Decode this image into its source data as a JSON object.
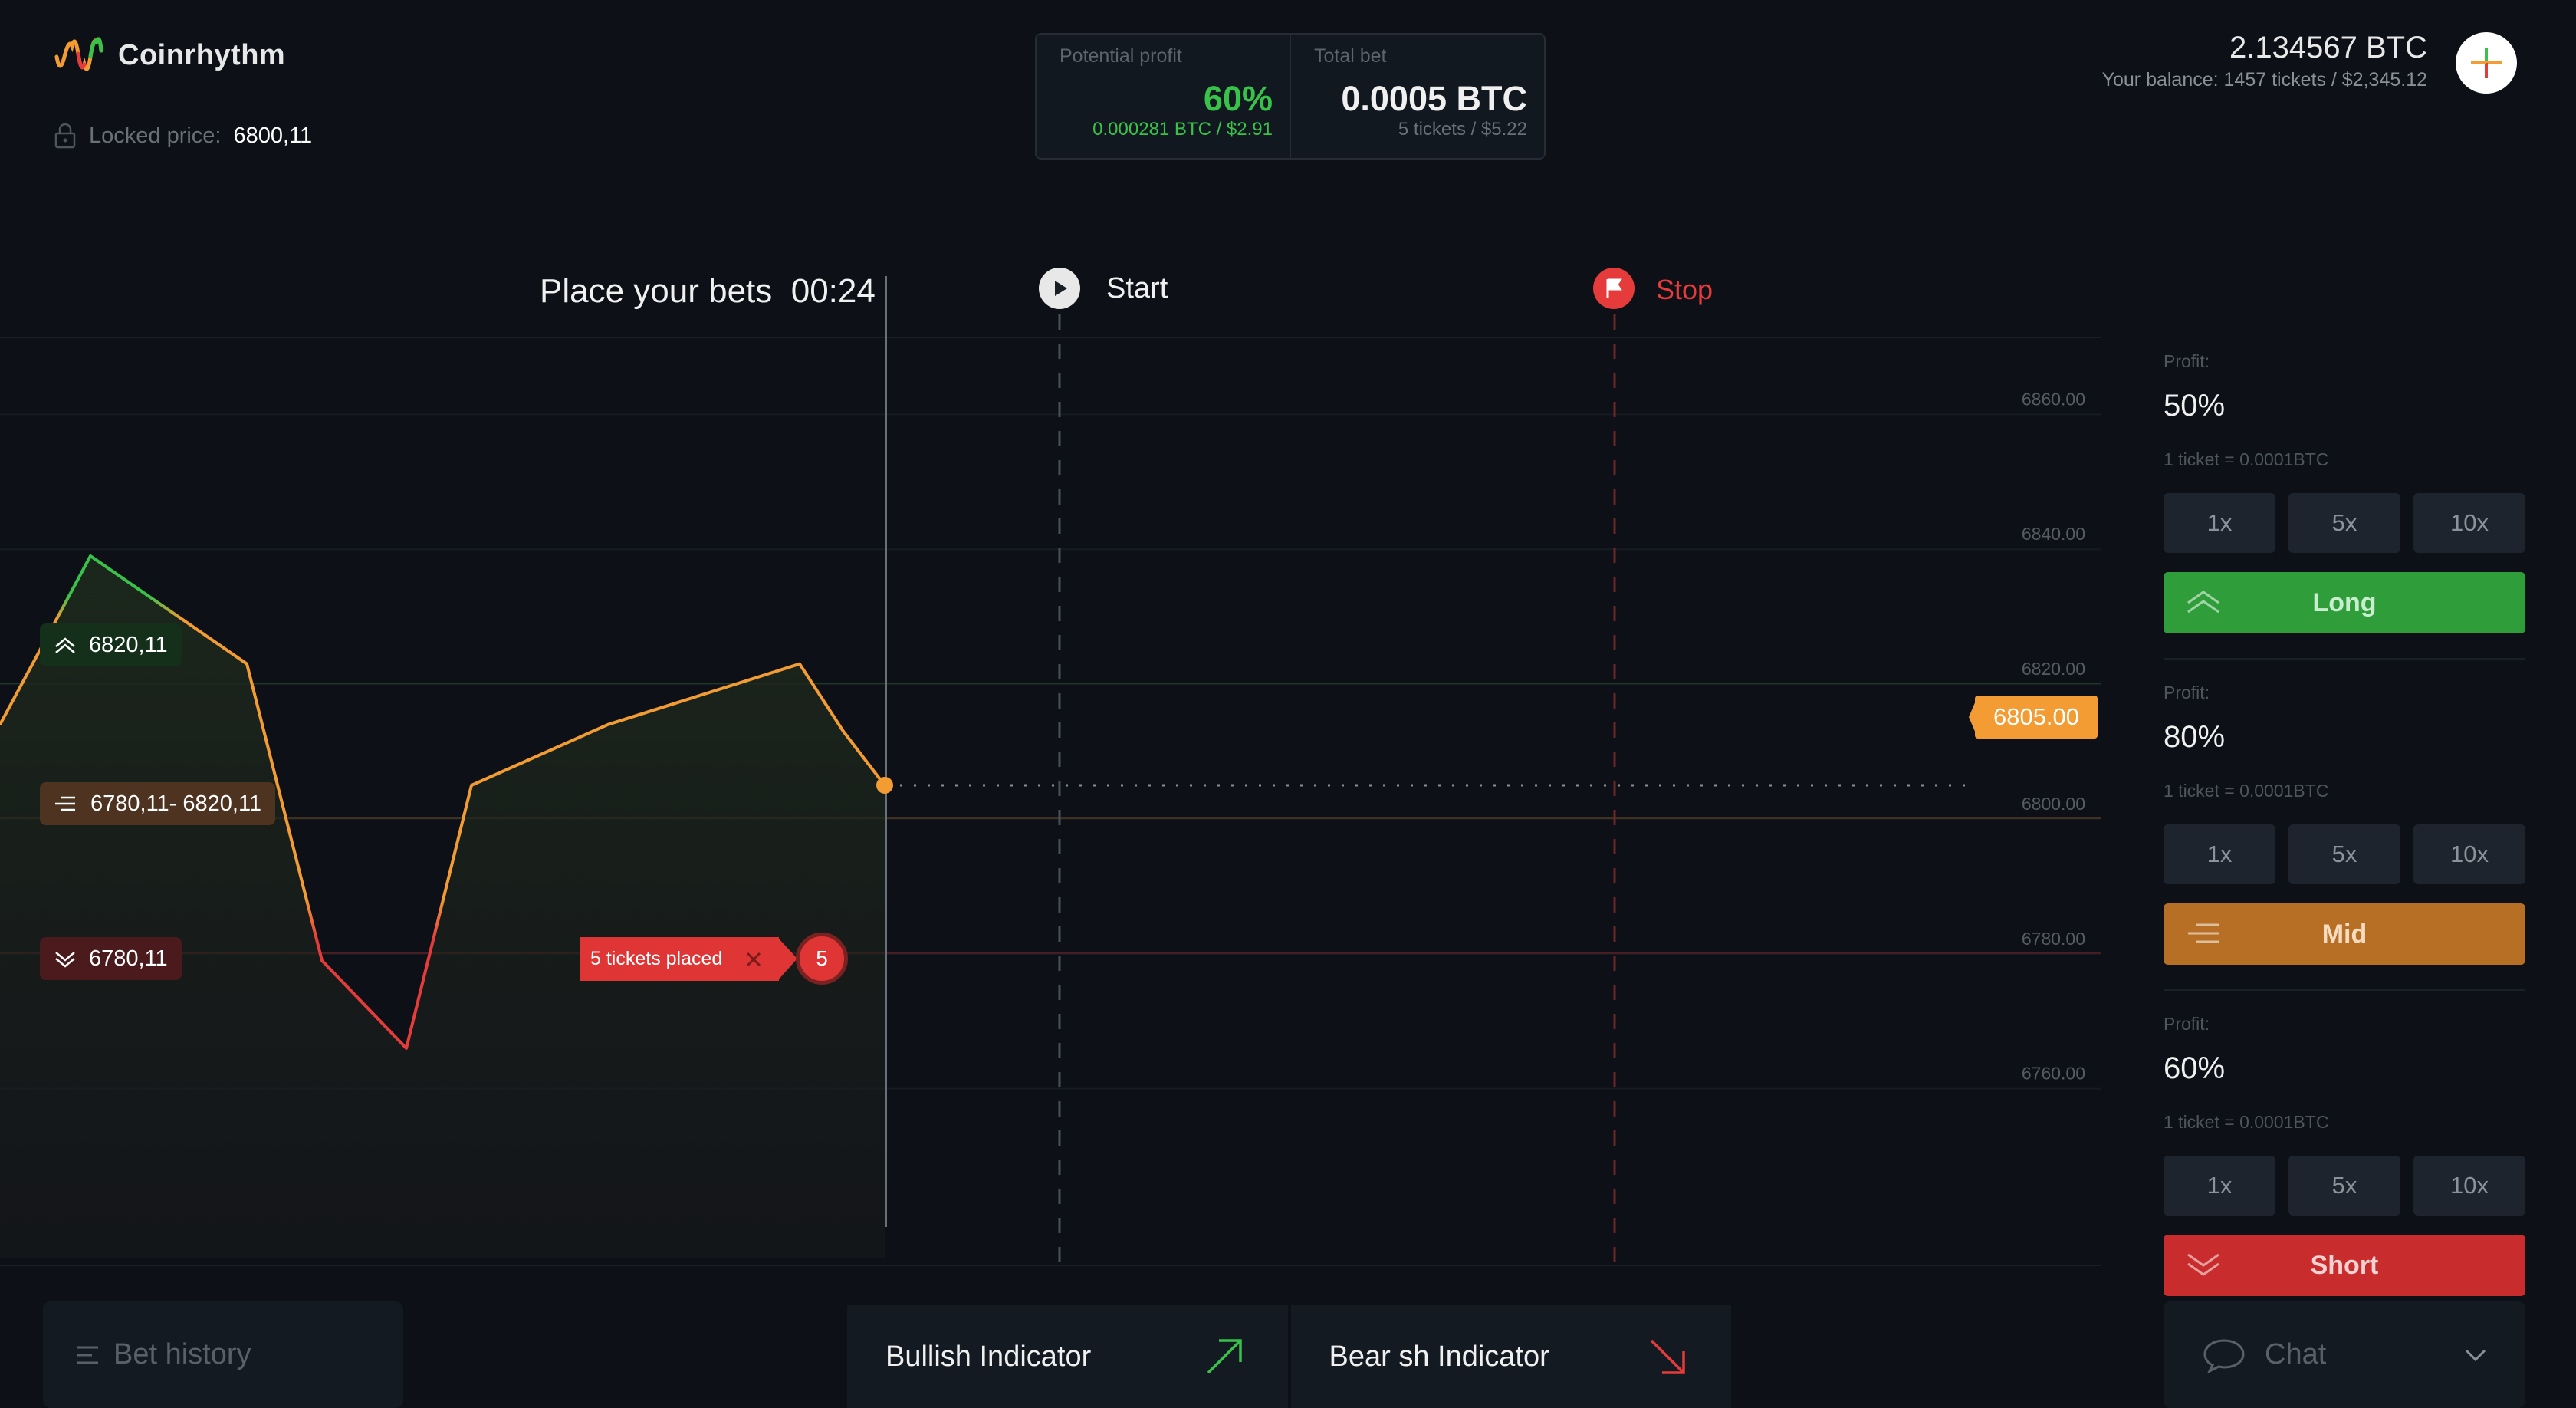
{
  "app": {
    "name": "Coinrhythm"
  },
  "locked_price": {
    "label": "Locked price:",
    "value": "6800,11"
  },
  "stats": {
    "potential_profit": {
      "title": "Potential profit",
      "value": "60%",
      "sub": "0.000281 BTC / $2.91"
    },
    "total_bet": {
      "title": "Total bet",
      "value": "0.0005 BTC",
      "sub": "5 tickets / $5.22"
    }
  },
  "balance": {
    "amount": "2.134567 BTC",
    "text": "Your balance: 1457 tickets / $2,345.12"
  },
  "round": {
    "bets_label": "Place your bets",
    "timer": "00:24",
    "start_label": "Start",
    "stop_label": "Stop"
  },
  "chart_data": {
    "type": "line",
    "y_ticks": [
      "6860.00",
      "6840.00",
      "6820.00",
      "6800.00",
      "6780.00",
      "6760.00"
    ],
    "ylim": [
      6752,
      6868
    ],
    "x": [
      0,
      1,
      2,
      3,
      4,
      5,
      6,
      7,
      8,
      9
    ],
    "y": [
      6814,
      6839,
      6823,
      6779,
      6766,
      6805,
      6814,
      6823,
      6813,
      6805
    ],
    "current_price": "6805.00",
    "levels": [
      {
        "name": "long",
        "label": "6820,11",
        "value": 6820.11
      },
      {
        "name": "mid",
        "label": "6780,11- 6820,11",
        "value": 6800.11
      },
      {
        "name": "short",
        "label": "6780,11",
        "value": 6780.11
      }
    ],
    "tickets": {
      "label": "5 tickets placed",
      "count": "5"
    }
  },
  "bets": [
    {
      "id": "long",
      "profit_label": "Profit:",
      "profit": "50%",
      "note": "1 ticket = 0.0001BTC",
      "multipliers": [
        "1x",
        "5x",
        "10x"
      ],
      "action": "Long",
      "color": "#2f9e3a"
    },
    {
      "id": "mid",
      "profit_label": "Profit:",
      "profit": "80%",
      "note": "1 ticket = 0.0001BTC",
      "multipliers": [
        "1x",
        "5x",
        "10x"
      ],
      "action": "Mid",
      "color": "#b76f25"
    },
    {
      "id": "short",
      "profit_label": "Profit:",
      "profit": "60%",
      "note": "1 ticket = 0.0001BTC",
      "multipliers": [
        "1x",
        "5x",
        "10x"
      ],
      "action": "Short",
      "color": "#c92c2c"
    }
  ],
  "bottom": {
    "bet_history": "Bet history",
    "bullish": "Bullish Indicator",
    "bearish": "Bear sh Indicator",
    "chat": "Chat"
  },
  "colors": {
    "green": "#39c24a",
    "orange": "#f39c33",
    "red": "#e63b3b",
    "background": "#0d1117"
  }
}
